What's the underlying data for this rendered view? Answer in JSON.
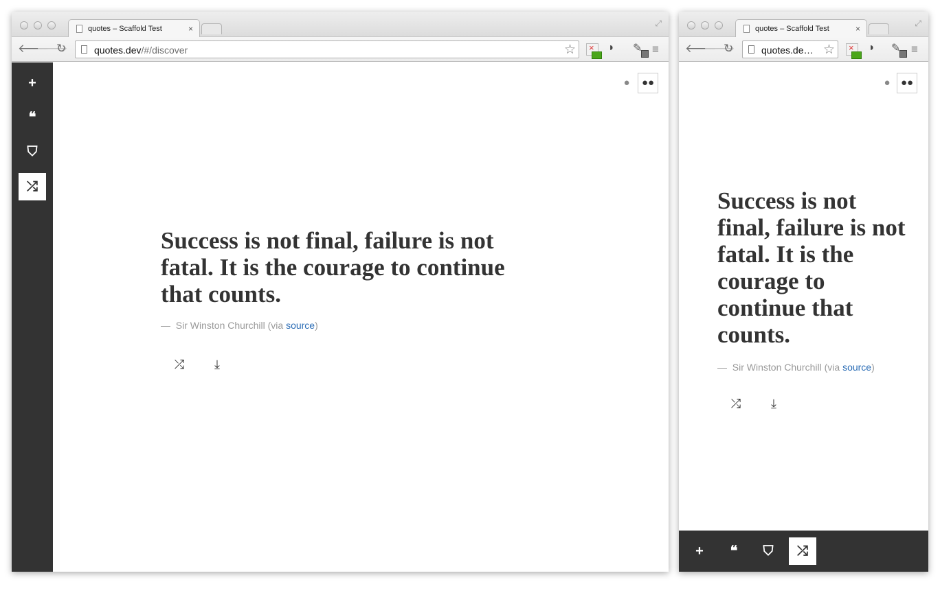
{
  "browser": {
    "tab_title": "quotes – Scaffold Test",
    "tab_close": "×",
    "url_host": "quotes.dev",
    "url_path": "/#/discover",
    "url_truncated": "quotes.de…"
  },
  "icons": {
    "back": "🡐",
    "forward": "🡒",
    "reload": "↻",
    "star": "☆",
    "menu": "≡",
    "fullscreen": "⤢",
    "add": "+",
    "quotes": "❝",
    "tags": "⛉",
    "shuffle": "⤮",
    "user": "●",
    "users": "●●",
    "download": "⤓",
    "evernote": "◗",
    "picker": "✎"
  },
  "sidebar": {
    "items": [
      {
        "id": "add",
        "icon": "plus-icon",
        "active": false
      },
      {
        "id": "quotes",
        "icon": "quote-icon",
        "active": false
      },
      {
        "id": "tags",
        "icon": "tags-icon",
        "active": false
      },
      {
        "id": "discover",
        "icon": "shuffle-icon",
        "active": true
      }
    ]
  },
  "quote": {
    "text": "Success is not final, failure is not fatal. It is the courage to continue that counts.",
    "dash": "—",
    "author": "Sir Winston Churchill",
    "via_prefix": "(via",
    "source_link": "source",
    "via_suffix": ")"
  },
  "colors": {
    "sidebar_bg": "#333333",
    "link": "#2a6cb5",
    "attribution": "#999999"
  }
}
